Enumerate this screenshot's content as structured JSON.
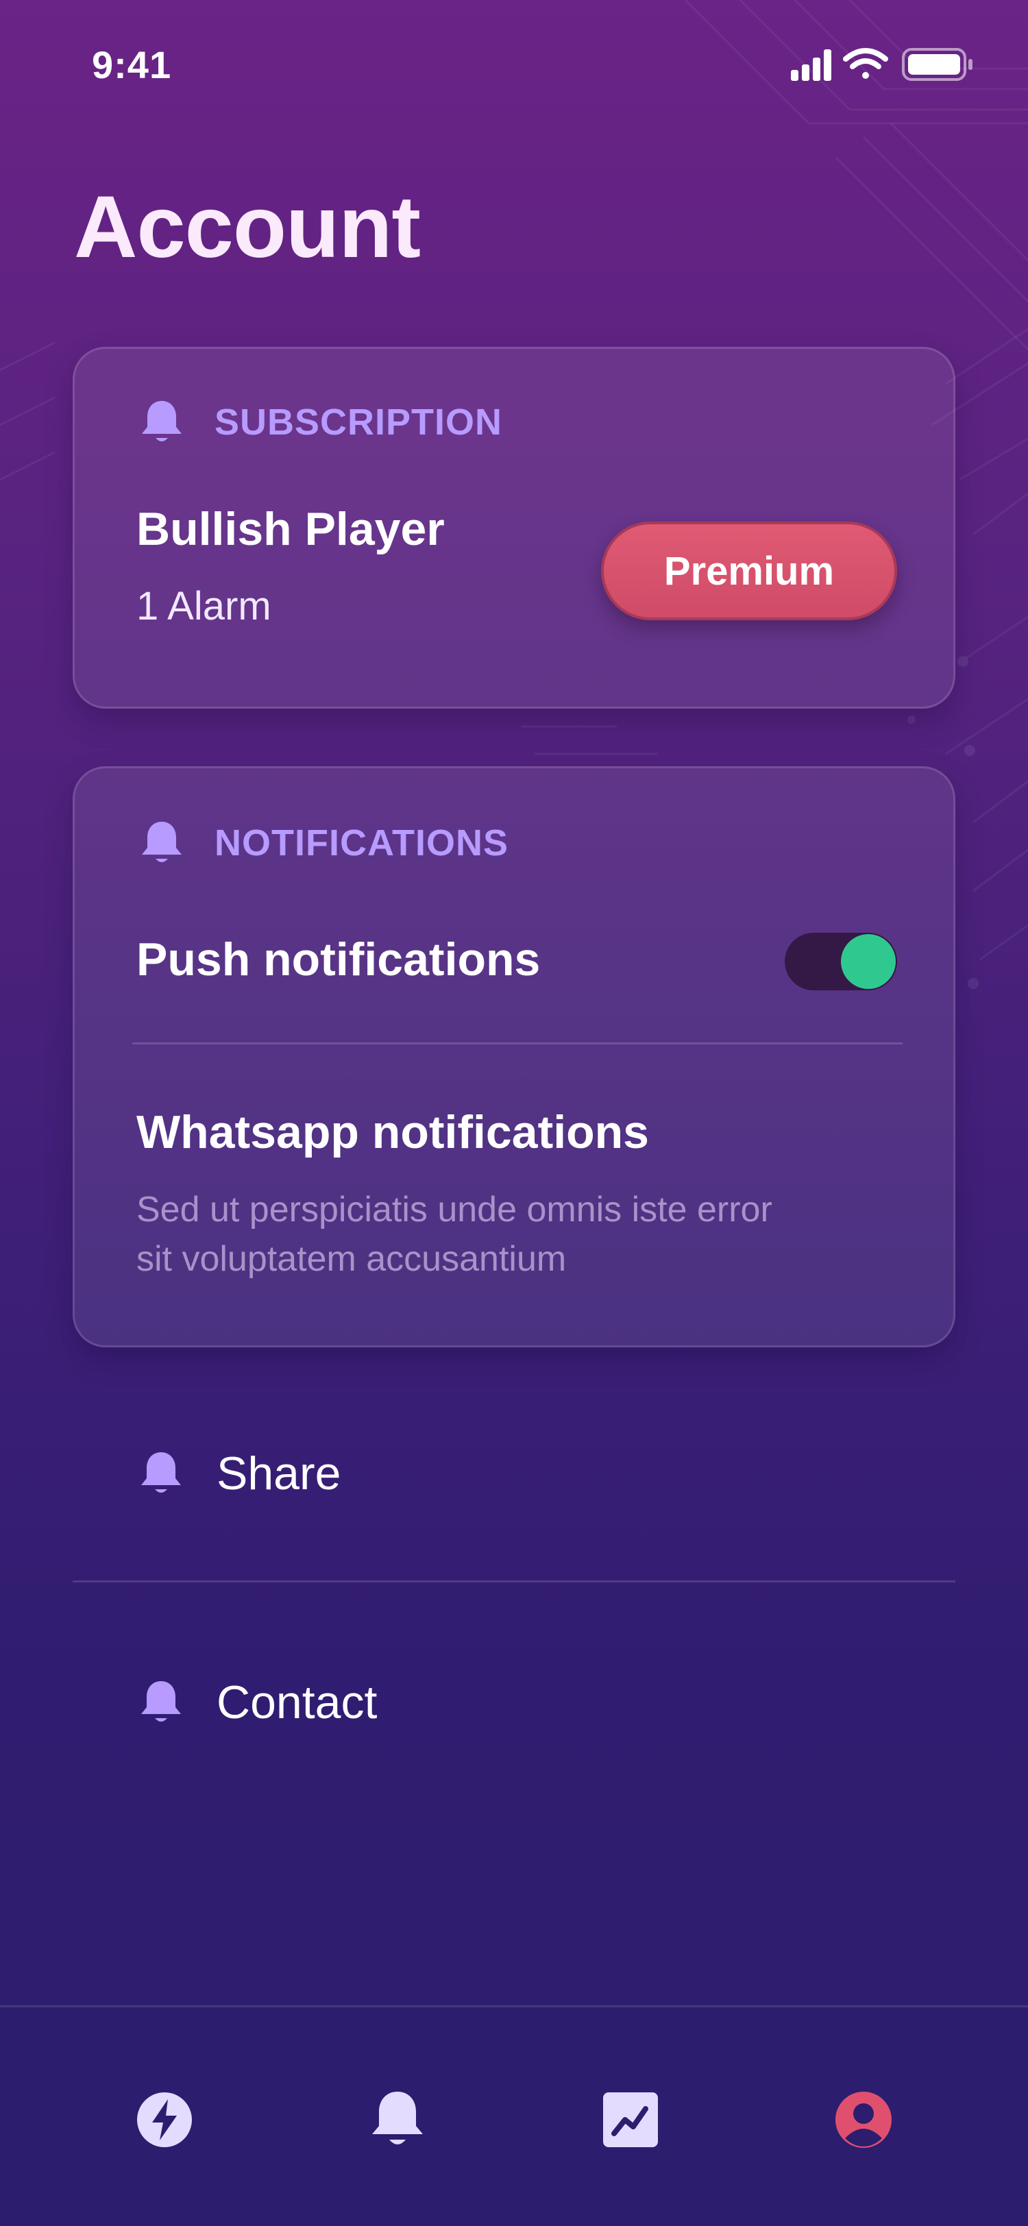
{
  "status_bar": {
    "time": "9:41",
    "icons": [
      "signal-icon",
      "wifi-icon",
      "battery-icon"
    ]
  },
  "page": {
    "title": "Account"
  },
  "subscription": {
    "section_label": "SUBSCRIPTION",
    "icon": "bell-icon",
    "plan_name": "Bullish Player",
    "plan_detail": "1 Alarm",
    "premium_button_label": "Premium"
  },
  "notifications": {
    "section_label": "NOTIFICATIONS",
    "icon": "bell-icon",
    "push_label": "Push notifications",
    "push_enabled": true,
    "whatsapp_label": "Whatsapp notifications",
    "whatsapp_description": "Sed ut perspiciatis unde omnis iste error sit voluptatem accusantium"
  },
  "menu": {
    "items": [
      {
        "label": "Share",
        "icon": "bell-icon"
      },
      {
        "label": "Contact",
        "icon": "bell-icon"
      }
    ]
  },
  "tab_bar": {
    "tabs": [
      {
        "icon": "lightning-icon",
        "active": false
      },
      {
        "icon": "bell-icon",
        "active": false
      },
      {
        "icon": "chart-icon",
        "active": false
      },
      {
        "icon": "profile-icon",
        "active": true
      }
    ]
  },
  "colors": {
    "accent_label": "#b79bff",
    "premium_button": "#d9516c",
    "toggle_on": "#2fc98f",
    "active_tab": "#e0506e"
  }
}
